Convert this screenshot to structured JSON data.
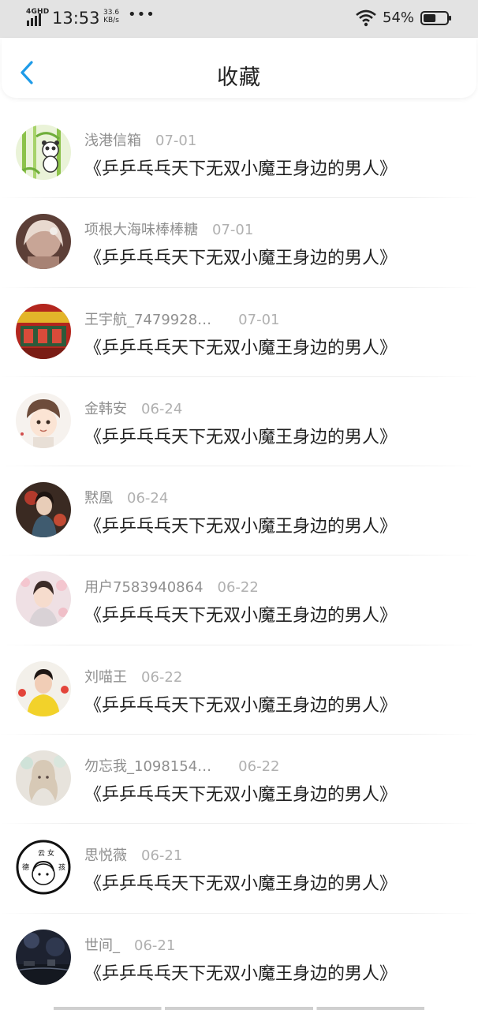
{
  "status_bar": {
    "network": "4GHD",
    "time": "13:53",
    "speed_value": "33.6",
    "speed_unit": "KB/s",
    "dots": "•••",
    "battery": "54%",
    "battery_level": 0.54
  },
  "header": {
    "title": "收藏"
  },
  "icons": {
    "back": "chevron-left-icon",
    "signal": "signal-icon",
    "wifi": "wifi-icon",
    "battery": "battery-icon"
  },
  "colors": {
    "accent": "#1e9be8",
    "user_text": "#8f8f8f",
    "date_text": "#b0b0b0",
    "title_text": "#1f1f1f"
  },
  "favorites": [
    {
      "user": "浅港信箱",
      "date": "07-01",
      "title": "《乒乒乓乓天下无双小魔王身边的男人》"
    },
    {
      "user": "项根大海味棒棒糖",
      "date": "07-01",
      "title": "《乒乒乓乓天下无双小魔王身边的男人》"
    },
    {
      "user": "王宇航_7479928…",
      "date": "07-01",
      "title": "《乒乒乓乓天下无双小魔王身边的男人》"
    },
    {
      "user": "金韩安",
      "date": "06-24",
      "title": "《乒乒乓乓天下无双小魔王身边的男人》"
    },
    {
      "user": "黙凰",
      "date": "06-24",
      "title": "《乒乒乓乓天下无双小魔王身边的男人》"
    },
    {
      "user": "用户7583940864",
      "date": "06-22",
      "title": "《乒乒乓乓天下无双小魔王身边的男人》"
    },
    {
      "user": "刘喵王",
      "date": "06-22",
      "title": "《乒乒乓乓天下无双小魔王身边的男人》"
    },
    {
      "user": "勿忘我_1098154…",
      "date": "06-22",
      "title": "《乒乒乓乓天下无双小魔王身边的男人》"
    },
    {
      "user": "思悦薇",
      "date": "06-21",
      "title": "《乒乒乓乓天下无双小魔王身边的男人》"
    },
    {
      "user": "世间_",
      "date": "06-21",
      "title": "《乒乒乓乓天下无双小魔王身边的男人》"
    }
  ],
  "avatar_badge": {
    "chars": [
      "云",
      "女",
      "德",
      "孩"
    ]
  }
}
